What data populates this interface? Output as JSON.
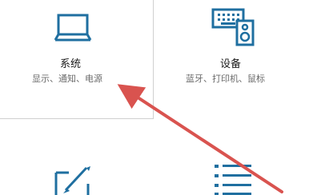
{
  "tiles": {
    "system": {
      "title": "系统",
      "desc": "显示、通知、电源",
      "icon": "laptop-icon"
    },
    "devices": {
      "title": "设备",
      "desc": "蓝牙、打印机、鼠标",
      "icon": "devices-icon"
    },
    "personalization": {
      "icon": "pen-tablet-icon"
    },
    "apps": {
      "icon": "list-icon"
    }
  },
  "colors": {
    "accent": "#1f6fa0",
    "annotation_arrow": "#d9534f",
    "selected_border": "#d0d0d0"
  }
}
